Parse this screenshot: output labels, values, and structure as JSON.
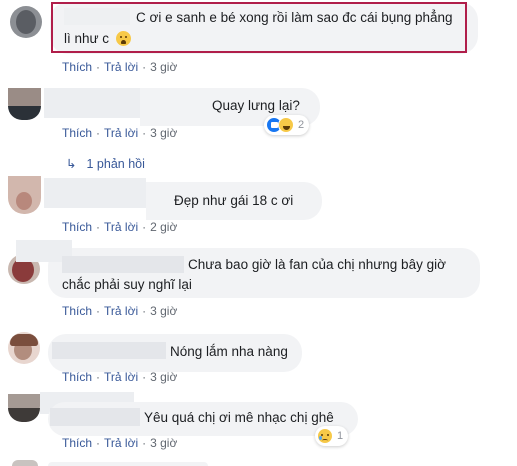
{
  "comments": [
    {
      "text_line1": "C ơi e sanh e bé xong rồi làm sao đc cái bụng phẳng",
      "text_line2": "lì như c",
      "emoji": "😭",
      "like": "Thích",
      "reply": "Trả lời",
      "time": "3 giờ"
    },
    {
      "text": "Quay lưng lại?",
      "like": "Thích",
      "reply": "Trả lời",
      "time": "3 giờ",
      "reaction_count": "2",
      "replies_label": "1 phản hồi"
    },
    {
      "text": "Đẹp như gái 18 c ơi",
      "like": "Thích",
      "reply": "Trả lời",
      "time": "2 giờ"
    },
    {
      "text_line1": "Chưa bao giờ là fan của chị nhưng bây giờ",
      "text_line2": "chắc phải suy nghĩ lại",
      "like": "Thích",
      "reply": "Trả lời",
      "time": "3 giờ"
    },
    {
      "text": "Nóng lắm nha nàng",
      "like": "Thích",
      "reply": "Trả lời",
      "time": "3 giờ"
    },
    {
      "text": "Yêu quá chị ơi mê nhạc chị ghê",
      "like": "Thích",
      "reply": "Trả lời",
      "time": "3 giờ",
      "reaction_count": "1"
    }
  ],
  "icons": {
    "reply_arrow": "↳",
    "like_reaction": "like-icon",
    "haha_reaction": "haha-icon",
    "sad_reaction": "sad-icon"
  },
  "colors": {
    "link": "#385898",
    "bubble": "#f2f3f5",
    "highlight": "#b01e4a"
  }
}
